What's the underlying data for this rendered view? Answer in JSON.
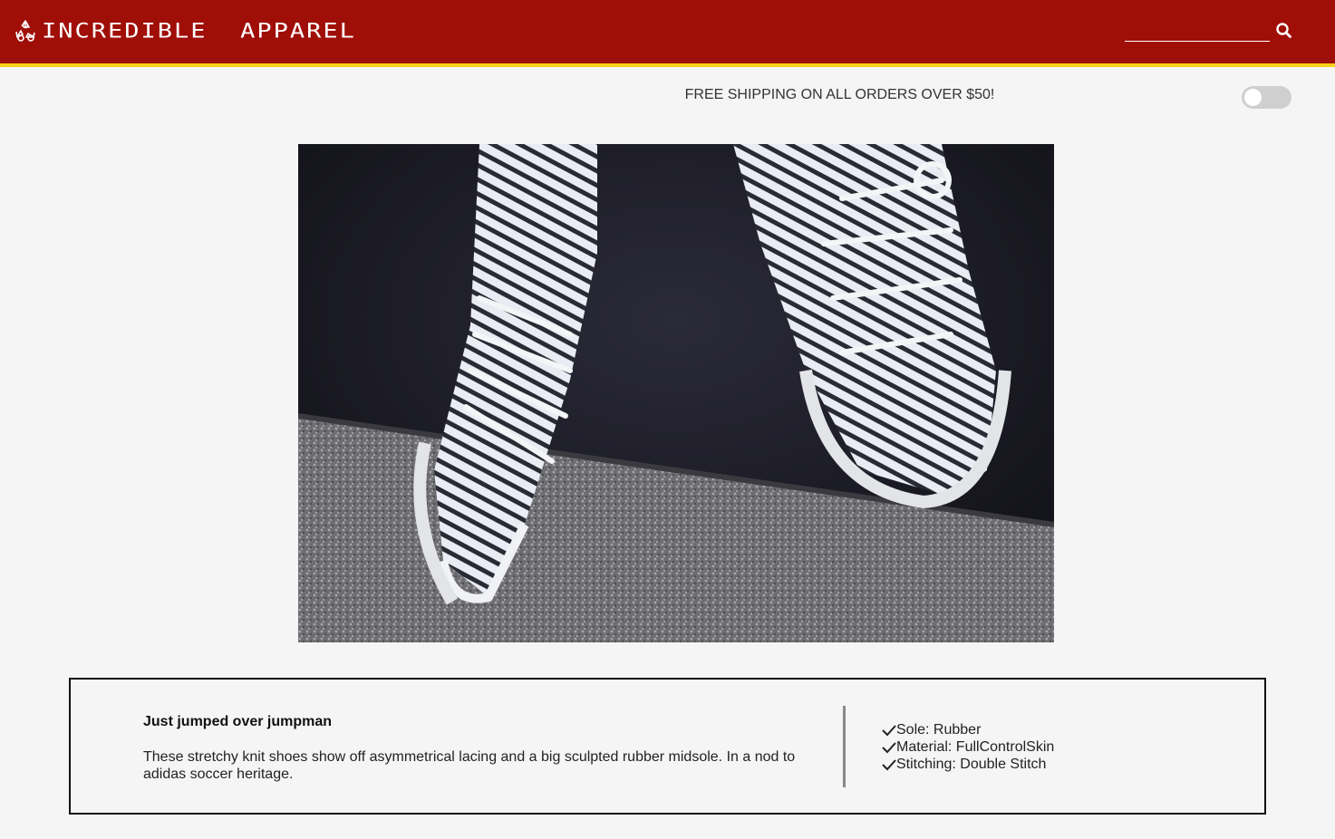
{
  "header": {
    "brand": "INCREDIBLE  APPAREL",
    "search_placeholder": "",
    "brand_color": "#a00e08",
    "accent_color": "#f7d21b"
  },
  "promo": {
    "text": "FREE SHIPPING ON ALL ORDERS OVER $50!"
  },
  "toggle": {
    "state": "off"
  },
  "hero": {
    "alt": "White and black knit sneakers on a concrete ledge"
  },
  "product": {
    "title": "Just jumped over jumpman",
    "description": "These stretchy knit shoes show off asymmetrical lacing and a big sculpted rubber midsole. In a nod to adidas soccer heritage.",
    "specs": [
      "Sole: Rubber",
      "Material: FullControlSkin",
      "Stitching: Double Stitch"
    ]
  },
  "icons": {
    "logo": "recycle-logo-icon",
    "search": "search-icon",
    "check": "check-icon"
  }
}
